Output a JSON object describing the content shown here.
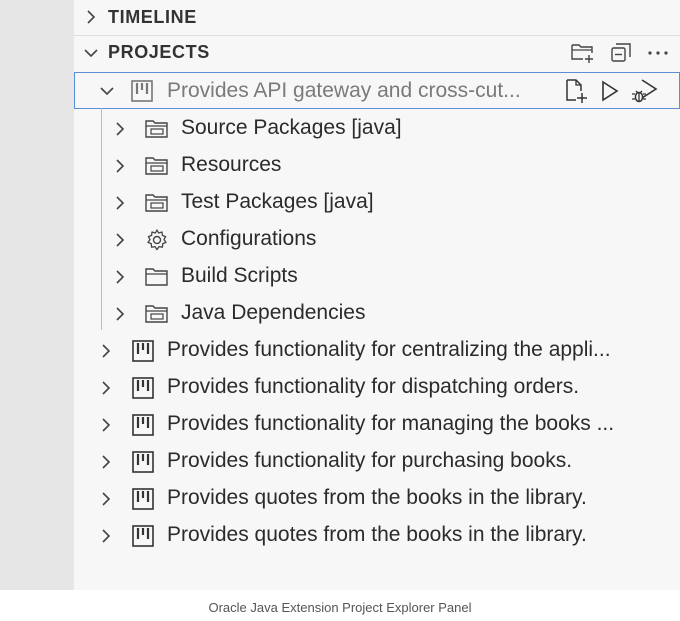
{
  "sections": {
    "timeline": {
      "title": "TIMELINE"
    },
    "projects": {
      "title": "PROJECTS",
      "actions": [
        {
          "icon": "new-folder-icon"
        },
        {
          "icon": "collapse-all-icon"
        },
        {
          "icon": "more-icon"
        }
      ]
    }
  },
  "tree": {
    "selected_project": {
      "label": "Provides API gateway and cross-cut...",
      "actions": [
        {
          "icon": "new-file-icon"
        },
        {
          "icon": "run-icon"
        },
        {
          "icon": "debug-icon"
        }
      ],
      "children": [
        {
          "label": "Source Packages [java]",
          "icon": "package-folder-icon"
        },
        {
          "label": "Resources",
          "icon": "package-folder-icon"
        },
        {
          "label": "Test Packages [java]",
          "icon": "package-folder-icon"
        },
        {
          "label": "Configurations",
          "icon": "gear-icon"
        },
        {
          "label": "Build Scripts",
          "icon": "folder-icon"
        },
        {
          "label": "Java Dependencies",
          "icon": "package-folder-icon"
        }
      ]
    },
    "projects": [
      {
        "label": "Provides functionality for centralizing the appli..."
      },
      {
        "label": "Provides functionality for dispatching orders."
      },
      {
        "label": "Provides functionality for managing the books ..."
      },
      {
        "label": "Provides functionality for purchasing books."
      },
      {
        "label": "Provides quotes from the books in the library."
      },
      {
        "label": "Provides quotes from the books in the library."
      }
    ]
  },
  "caption": "Oracle Java Extension Project Explorer Panel",
  "colors": {
    "selection_border": "#5b8ed8",
    "sidebar_bg": "#f7f7f7",
    "activity_bg": "#e6e6e6"
  }
}
